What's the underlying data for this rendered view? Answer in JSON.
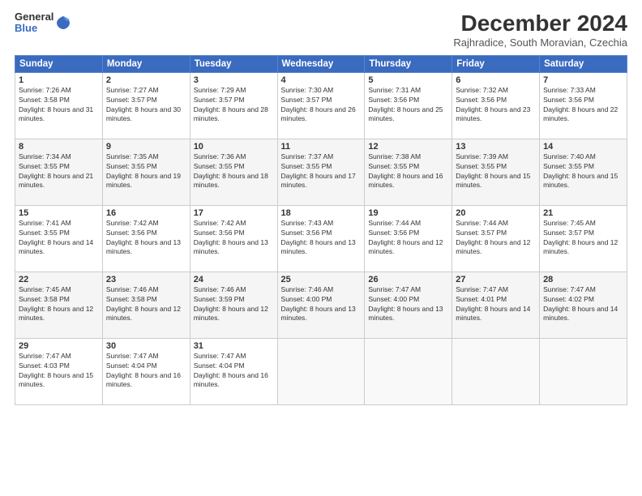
{
  "logo": {
    "line1": "General",
    "line2": "Blue"
  },
  "title": "December 2024",
  "location": "Rajhradice, South Moravian, Czechia",
  "days_header": [
    "Sunday",
    "Monday",
    "Tuesday",
    "Wednesday",
    "Thursday",
    "Friday",
    "Saturday"
  ],
  "weeks": [
    [
      {
        "day": "1",
        "sunrise": "7:26 AM",
        "sunset": "3:58 PM",
        "daylight": "8 hours and 31 minutes."
      },
      {
        "day": "2",
        "sunrise": "7:27 AM",
        "sunset": "3:57 PM",
        "daylight": "8 hours and 30 minutes."
      },
      {
        "day": "3",
        "sunrise": "7:29 AM",
        "sunset": "3:57 PM",
        "daylight": "8 hours and 28 minutes."
      },
      {
        "day": "4",
        "sunrise": "7:30 AM",
        "sunset": "3:57 PM",
        "daylight": "8 hours and 26 minutes."
      },
      {
        "day": "5",
        "sunrise": "7:31 AM",
        "sunset": "3:56 PM",
        "daylight": "8 hours and 25 minutes."
      },
      {
        "day": "6",
        "sunrise": "7:32 AM",
        "sunset": "3:56 PM",
        "daylight": "8 hours and 23 minutes."
      },
      {
        "day": "7",
        "sunrise": "7:33 AM",
        "sunset": "3:56 PM",
        "daylight": "8 hours and 22 minutes."
      }
    ],
    [
      {
        "day": "8",
        "sunrise": "7:34 AM",
        "sunset": "3:55 PM",
        "daylight": "8 hours and 21 minutes."
      },
      {
        "day": "9",
        "sunrise": "7:35 AM",
        "sunset": "3:55 PM",
        "daylight": "8 hours and 19 minutes."
      },
      {
        "day": "10",
        "sunrise": "7:36 AM",
        "sunset": "3:55 PM",
        "daylight": "8 hours and 18 minutes."
      },
      {
        "day": "11",
        "sunrise": "7:37 AM",
        "sunset": "3:55 PM",
        "daylight": "8 hours and 17 minutes."
      },
      {
        "day": "12",
        "sunrise": "7:38 AM",
        "sunset": "3:55 PM",
        "daylight": "8 hours and 16 minutes."
      },
      {
        "day": "13",
        "sunrise": "7:39 AM",
        "sunset": "3:55 PM",
        "daylight": "8 hours and 15 minutes."
      },
      {
        "day": "14",
        "sunrise": "7:40 AM",
        "sunset": "3:55 PM",
        "daylight": "8 hours and 15 minutes."
      }
    ],
    [
      {
        "day": "15",
        "sunrise": "7:41 AM",
        "sunset": "3:55 PM",
        "daylight": "8 hours and 14 minutes."
      },
      {
        "day": "16",
        "sunrise": "7:42 AM",
        "sunset": "3:56 PM",
        "daylight": "8 hours and 13 minutes."
      },
      {
        "day": "17",
        "sunrise": "7:42 AM",
        "sunset": "3:56 PM",
        "daylight": "8 hours and 13 minutes."
      },
      {
        "day": "18",
        "sunrise": "7:43 AM",
        "sunset": "3:56 PM",
        "daylight": "8 hours and 13 minutes."
      },
      {
        "day": "19",
        "sunrise": "7:44 AM",
        "sunset": "3:56 PM",
        "daylight": "8 hours and 12 minutes."
      },
      {
        "day": "20",
        "sunrise": "7:44 AM",
        "sunset": "3:57 PM",
        "daylight": "8 hours and 12 minutes."
      },
      {
        "day": "21",
        "sunrise": "7:45 AM",
        "sunset": "3:57 PM",
        "daylight": "8 hours and 12 minutes."
      }
    ],
    [
      {
        "day": "22",
        "sunrise": "7:45 AM",
        "sunset": "3:58 PM",
        "daylight": "8 hours and 12 minutes."
      },
      {
        "day": "23",
        "sunrise": "7:46 AM",
        "sunset": "3:58 PM",
        "daylight": "8 hours and 12 minutes."
      },
      {
        "day": "24",
        "sunrise": "7:46 AM",
        "sunset": "3:59 PM",
        "daylight": "8 hours and 12 minutes."
      },
      {
        "day": "25",
        "sunrise": "7:46 AM",
        "sunset": "4:00 PM",
        "daylight": "8 hours and 13 minutes."
      },
      {
        "day": "26",
        "sunrise": "7:47 AM",
        "sunset": "4:00 PM",
        "daylight": "8 hours and 13 minutes."
      },
      {
        "day": "27",
        "sunrise": "7:47 AM",
        "sunset": "4:01 PM",
        "daylight": "8 hours and 14 minutes."
      },
      {
        "day": "28",
        "sunrise": "7:47 AM",
        "sunset": "4:02 PM",
        "daylight": "8 hours and 14 minutes."
      }
    ],
    [
      {
        "day": "29",
        "sunrise": "7:47 AM",
        "sunset": "4:03 PM",
        "daylight": "8 hours and 15 minutes."
      },
      {
        "day": "30",
        "sunrise": "7:47 AM",
        "sunset": "4:04 PM",
        "daylight": "8 hours and 16 minutes."
      },
      {
        "day": "31",
        "sunrise": "7:47 AM",
        "sunset": "4:04 PM",
        "daylight": "8 hours and 16 minutes."
      },
      null,
      null,
      null,
      null
    ]
  ],
  "labels": {
    "sunrise": "Sunrise:",
    "sunset": "Sunset:",
    "daylight": "Daylight:"
  }
}
